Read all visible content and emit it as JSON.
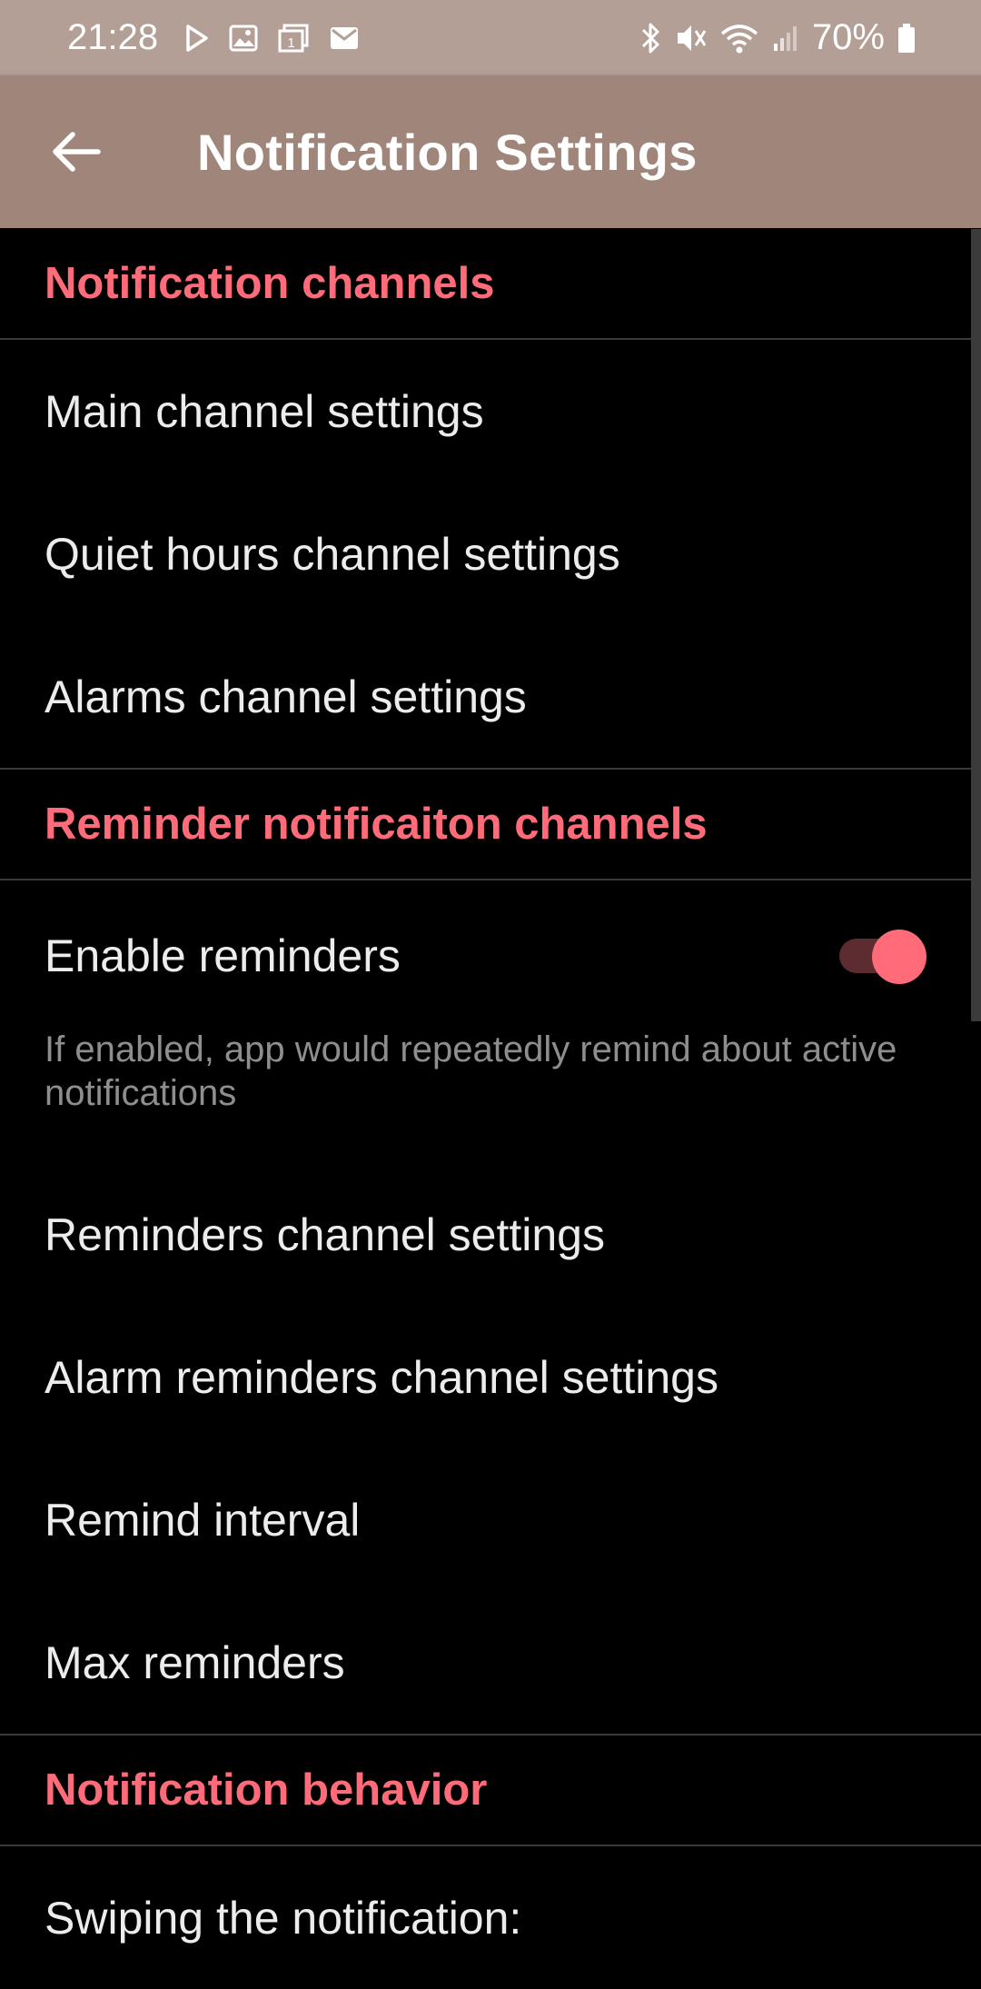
{
  "status_bar": {
    "time": "21:28",
    "battery": "70%",
    "left_icons": [
      "play-store-icon",
      "gallery-icon",
      "calendar-icon",
      "mail-icon"
    ],
    "right_icons": [
      "bluetooth-icon",
      "mute-icon",
      "wifi-icon",
      "signal-icon",
      "battery-icon"
    ]
  },
  "app_bar": {
    "title": "Notification Settings",
    "back_icon": "arrow-back-icon"
  },
  "colors": {
    "status_bar": "#b49f97",
    "app_bar": "#a0867a",
    "accent": "#ff6b78",
    "background": "#000000"
  },
  "sections": [
    {
      "header": "Notification channels",
      "items": [
        "Main channel settings",
        "Quiet hours channel settings",
        "Alarms channel settings"
      ]
    },
    {
      "header": "Reminder notificaiton channels",
      "toggle": {
        "title": "Enable reminders",
        "summary": "If enabled, app would repeatedly remind about active notifications",
        "checked": true
      },
      "items": [
        "Reminders channel settings",
        "Alarm reminders channel settings",
        "Remind interval",
        "Max reminders"
      ]
    },
    {
      "header": "Notification behavior",
      "items": [
        "Swiping the notification:"
      ]
    }
  ]
}
